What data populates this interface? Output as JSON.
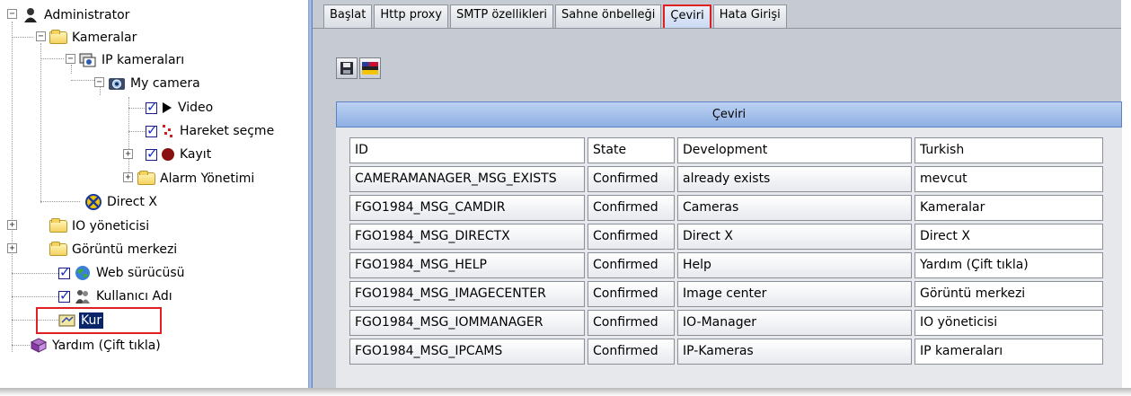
{
  "tree": {
    "nodes": [
      {
        "label": "Administrator",
        "icon": "user-icon",
        "toggle": "−"
      },
      {
        "label": "Kameralar",
        "icon": "folder-icon",
        "toggle": "−"
      },
      {
        "label": "IP kameraları",
        "icon": "network-camera-icon",
        "toggle": "−"
      },
      {
        "label": "My camera",
        "icon": "camera-icon",
        "toggle": "−"
      },
      {
        "label": "Video",
        "icon": "play-icon"
      },
      {
        "label": "Hareket seçme",
        "icon": "motion-icon"
      },
      {
        "label": "Kayıt",
        "icon": "record-icon",
        "toggle": "+"
      },
      {
        "label": "Alarm Yönetimi",
        "icon": "folder-icon",
        "toggle": "+"
      },
      {
        "label": "Direct X",
        "icon": "directx-icon"
      },
      {
        "label": "IO yöneticisi",
        "icon": "folder-icon",
        "toggle": "+"
      },
      {
        "label": "Görüntü merkezi",
        "icon": "folder-icon",
        "toggle": "+"
      },
      {
        "label": "Web sürücüsü",
        "icon": "globe-icon"
      },
      {
        "label": "Kullanıcı Adı",
        "icon": "users-icon"
      },
      {
        "label": "Kur",
        "icon": "setup-icon"
      },
      {
        "label": "Yardım (Çift tıkla)",
        "icon": "help-book-icon"
      }
    ]
  },
  "tabs": [
    "Başlat",
    "Http proxy",
    "SMTP özellikleri",
    "Sahne önbelleği",
    "Çeviri",
    "Hata Girişi"
  ],
  "active_tab": "Çeviri",
  "grid": {
    "title": "Çeviri",
    "headers": [
      "ID",
      "State",
      "Development",
      "Turkish"
    ],
    "rows": [
      [
        "CAMERAMANAGER_MSG_EXISTS",
        "Confirmed",
        "already exists",
        "mevcut"
      ],
      [
        "FGO1984_MSG_CAMDIR",
        "Confirmed",
        "Cameras",
        "Kameralar"
      ],
      [
        "FGO1984_MSG_DIRECTX",
        "Confirmed",
        "Direct X",
        "Direct X"
      ],
      [
        "FGO1984_MSG_HELP",
        "Confirmed",
        "Help",
        "Yardım (Çift tıkla)"
      ],
      [
        "FGO1984_MSG_IMAGECENTER",
        "Confirmed",
        "Image center",
        "Görüntü merkezi"
      ],
      [
        "FGO1984_MSG_IOMMANAGER",
        "Confirmed",
        "IO-Manager",
        "IO yöneticisi"
      ],
      [
        "FGO1984_MSG_IPCAMS",
        "Confirmed",
        "IP-Kameras",
        "IP kameraları"
      ]
    ]
  },
  "colors": {
    "selection_outline": "#e02020",
    "selected_bg": "#0a246a",
    "header_blue": "#8fb0e4",
    "pane_bg": "#c6cbd3"
  }
}
